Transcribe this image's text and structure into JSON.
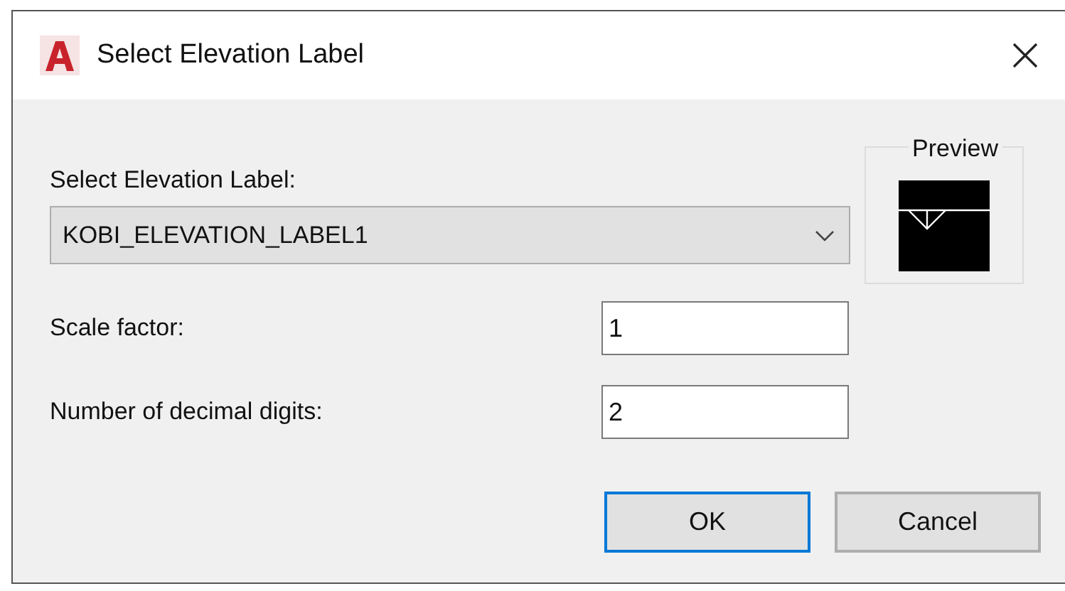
{
  "window": {
    "title": "Select Elevation Label"
  },
  "label_select": "Select Elevation Label:",
  "dropdown": {
    "value": "KOBI_ELEVATION_LABEL1"
  },
  "preview": {
    "title": "Preview"
  },
  "fields": [
    {
      "label": "Scale factor:",
      "value": "1"
    },
    {
      "label": "Number of decimal digits:",
      "value": "2"
    }
  ],
  "buttons": [
    {
      "label": "OK",
      "default": true
    },
    {
      "label": "Cancel",
      "default": false
    }
  ]
}
